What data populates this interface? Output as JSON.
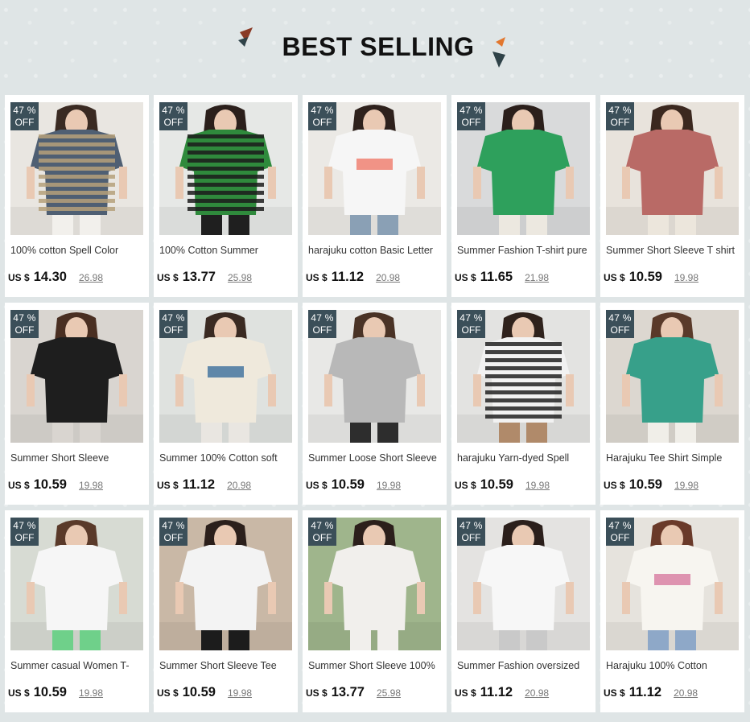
{
  "header": {
    "title": "BEST SELLING"
  },
  "colors": {
    "badge": "#3b4f59",
    "deco_dark": "#2f4248",
    "deco_accent": "#c0492b",
    "deco_orange": "#e2772e"
  },
  "products": [
    {
      "discount_pct": "47 %",
      "discount_off": "OFF",
      "name": "100% cotton Spell Color",
      "currency": "US $",
      "price": "14.30",
      "original_price": "26.98",
      "image": "striped-polo-tee-photo"
    },
    {
      "discount_pct": "47 %",
      "discount_off": "OFF",
      "name": "100% Cotton Summer",
      "currency": "US $",
      "price": "13.77",
      "original_price": "25.98",
      "image": "green-striped-polo-photo"
    },
    {
      "discount_pct": "47 %",
      "discount_off": "OFF",
      "name": "harajuku cotton Basic Letter",
      "currency": "US $",
      "price": "11.12",
      "original_price": "20.98",
      "image": "white-letter-tee-photo"
    },
    {
      "discount_pct": "47 %",
      "discount_off": "OFF",
      "name": "Summer Fashion T-shirt pure",
      "currency": "US $",
      "price": "11.65",
      "original_price": "21.98",
      "image": "green-print-tee-photo"
    },
    {
      "discount_pct": "47 %",
      "discount_off": "OFF",
      "name": "Summer Short Sleeve T shirt",
      "currency": "US $",
      "price": "10.59",
      "original_price": "19.98",
      "image": "pink-thank-tee-photo"
    },
    {
      "discount_pct": "47 %",
      "discount_off": "OFF",
      "name": "Summer Short Sleeve",
      "currency": "US $",
      "price": "10.59",
      "original_price": "19.98",
      "image": "black-letter-tee-photo"
    },
    {
      "discount_pct": "47 %",
      "discount_off": "OFF",
      "name": "Summer 100% Cotton soft",
      "currency": "US $",
      "price": "11.12",
      "original_price": "20.98",
      "image": "beige-graphic-tee-photo"
    },
    {
      "discount_pct": "47 %",
      "discount_off": "OFF",
      "name": "Summer Loose Short Sleeve",
      "currency": "US $",
      "price": "10.59",
      "original_price": "19.98",
      "image": "grey-90-tee-photo"
    },
    {
      "discount_pct": "47 %",
      "discount_off": "OFF",
      "name": "harajuku Yarn-dyed Spell",
      "currency": "US $",
      "price": "10.59",
      "original_price": "19.98",
      "image": "black-white-stripe-tee-photo"
    },
    {
      "discount_pct": "47 %",
      "discount_off": "OFF",
      "name": "Harajuku Tee Shirt Simple",
      "currency": "US $",
      "price": "10.59",
      "original_price": "19.98",
      "image": "teal-piec-tee-photo"
    },
    {
      "discount_pct": "47 %",
      "discount_off": "OFF",
      "name": "Summer casual Women T-",
      "currency": "US $",
      "price": "10.59",
      "original_price": "19.98",
      "image": "panda-tee-photo"
    },
    {
      "discount_pct": "47 %",
      "discount_off": "OFF",
      "name": "Summer Short Sleeve Tee",
      "currency": "US $",
      "price": "10.59",
      "original_price": "19.98",
      "image": "portrait-print-tee-photo"
    },
    {
      "discount_pct": "47 %",
      "discount_off": "OFF",
      "name": "Summer Short Sleeve 100%",
      "currency": "US $",
      "price": "13.77",
      "original_price": "25.98",
      "image": "long-white-tee-dress-photo"
    },
    {
      "discount_pct": "47 %",
      "discount_off": "OFF",
      "name": "Summer Fashion oversized",
      "currency": "US $",
      "price": "11.12",
      "original_price": "20.98",
      "image": "white-hibryda-tee-photo"
    },
    {
      "discount_pct": "47 %",
      "discount_off": "OFF",
      "name": "Harajuku 100% Cotton",
      "currency": "US $",
      "price": "11.12",
      "original_price": "20.98",
      "image": "floral-print-tee-photo"
    }
  ]
}
